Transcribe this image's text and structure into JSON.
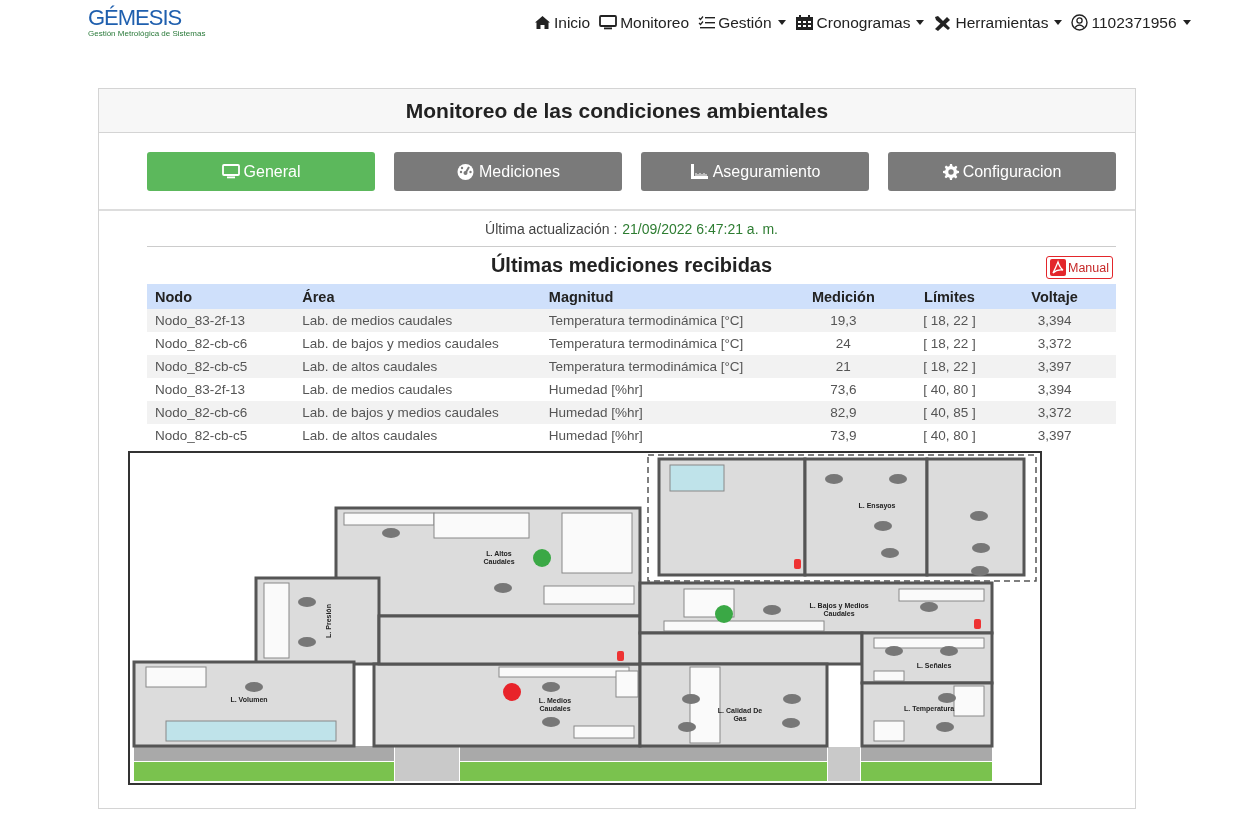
{
  "header": {
    "logo": {
      "name": "GÉMESIS",
      "tagline": "Gestión Metrológica de Sistemas"
    },
    "nav": [
      {
        "label": "Inicio",
        "kind": "link"
      },
      {
        "label": "Monitoreo",
        "kind": "link"
      },
      {
        "label": "Gestión",
        "kind": "dropdown"
      },
      {
        "label": "Cronogramas",
        "kind": "dropdown"
      },
      {
        "label": "Herramientas",
        "kind": "dropdown"
      },
      {
        "label": "1102371956",
        "kind": "dropdown"
      }
    ]
  },
  "panel": {
    "title": "Monitoreo de las condiciones ambientales",
    "tabs": [
      {
        "label": "General",
        "selected": true
      },
      {
        "label": "Mediciones",
        "selected": false
      },
      {
        "label": "Aseguramiento",
        "selected": false
      },
      {
        "label": "Configuracion",
        "selected": false
      }
    ],
    "last_update": {
      "label": "Última actualización :",
      "value": "21/09/2022 6:47:21 a. m."
    },
    "table": {
      "title": "Últimas mediciones recibidas",
      "manual_button": "Manual",
      "columns": [
        "Nodo",
        "Área",
        "Magnitud",
        "Medición",
        "Límites",
        "Voltaje"
      ],
      "rows": [
        [
          "Nodo_83-2f-13",
          "Lab. de medios caudales",
          "Temperatura termodinámica [°C]",
          "19,3",
          "[ 18, 22 ]",
          "3,394"
        ],
        [
          "Nodo_82-cb-c6",
          "Lab. de bajos y medios caudales",
          "Temperatura termodinámica [°C]",
          "24",
          "[ 18, 22 ]",
          "3,372"
        ],
        [
          "Nodo_82-cb-c5",
          "Lab. de altos caudales",
          "Temperatura termodinámica [°C]",
          "21",
          "[ 18, 22 ]",
          "3,397"
        ],
        [
          "Nodo_83-2f-13",
          "Lab. de medios caudales",
          "Humedad [%hr]",
          "73,6",
          "[ 40, 80 ]",
          "3,394"
        ],
        [
          "Nodo_82-cb-c6",
          "Lab. de bajos y medios caudales",
          "Humedad [%hr]",
          "82,9",
          "[ 40, 85 ]",
          "3,372"
        ],
        [
          "Nodo_82-cb-c5",
          "Lab. de altos caudales",
          "Humedad [%hr]",
          "73,9",
          "[ 40, 80 ]",
          "3,397"
        ]
      ]
    },
    "floor_plan": {
      "rooms": [
        {
          "lines": [
            "L. Altos",
            "Caudales"
          ]
        },
        {
          "lines": [
            "L. Presión"
          ]
        },
        {
          "lines": [
            "L. Volumen"
          ]
        },
        {
          "lines": [
            "L. Medios",
            "Caudales"
          ]
        },
        {
          "lines": [
            "L. Ensayos"
          ]
        },
        {
          "lines": [
            "L. Bajos y Medios",
            "Caudales"
          ]
        },
        {
          "lines": [
            "L. Señales"
          ]
        },
        {
          "lines": [
            "L. Calidad De",
            "Gas"
          ]
        },
        {
          "lines": [
            "L. Temperatura"
          ]
        }
      ],
      "sensors": [
        {
          "color": "#3aa845"
        },
        {
          "color": "#3aa845"
        },
        {
          "color": "#e8232a"
        }
      ]
    }
  }
}
